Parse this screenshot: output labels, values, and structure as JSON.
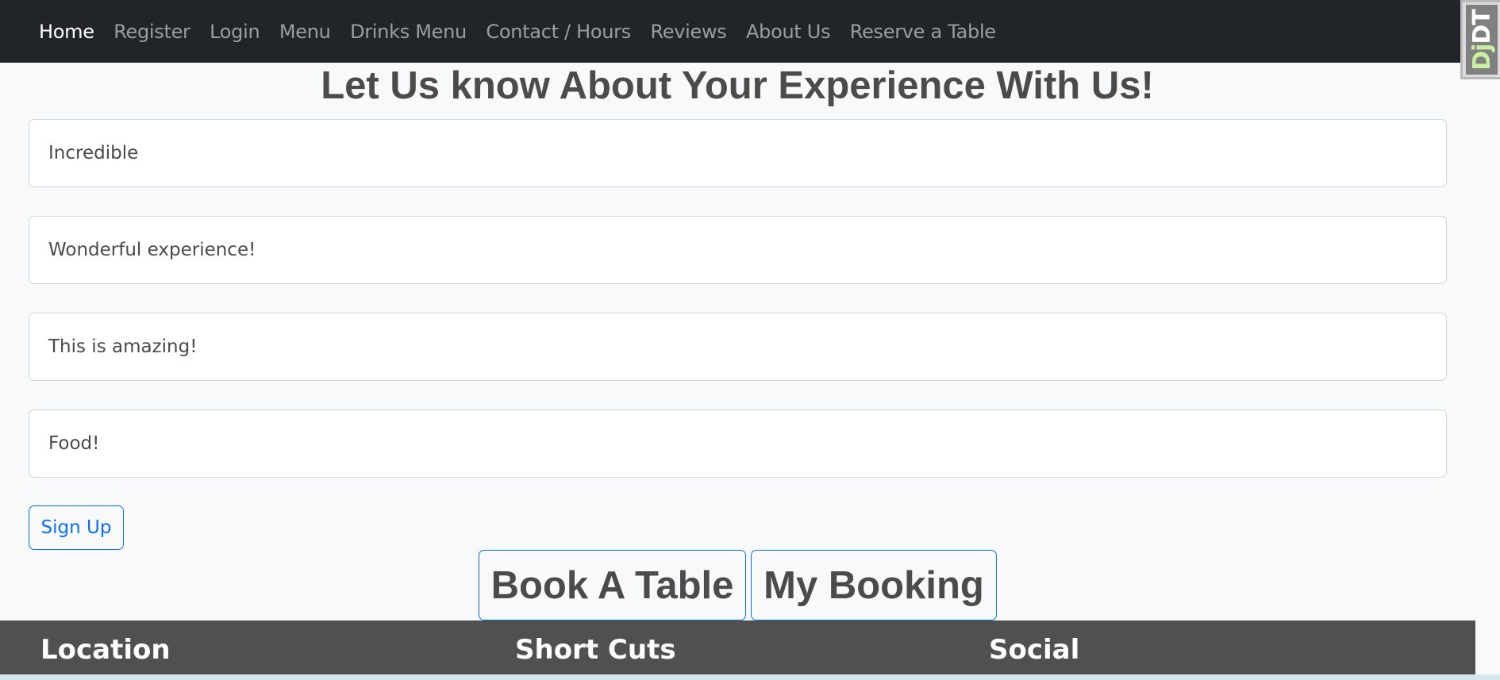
{
  "nav": {
    "items": [
      {
        "label": "Home",
        "active": true
      },
      {
        "label": "Register",
        "active": false
      },
      {
        "label": "Login",
        "active": false
      },
      {
        "label": "Menu",
        "active": false
      },
      {
        "label": "Drinks Menu",
        "active": false
      },
      {
        "label": "Contact / Hours",
        "active": false
      },
      {
        "label": "Reviews",
        "active": false
      },
      {
        "label": "About Us",
        "active": false
      },
      {
        "label": "Reserve a Table",
        "active": false
      }
    ]
  },
  "djdt": {
    "label_dj": "Dj",
    "label_dt": "DT"
  },
  "page": {
    "title": "Let Us know About Your Experience With Us!"
  },
  "reviews": [
    {
      "text": "Incredible"
    },
    {
      "text": "Wonderful experience!"
    },
    {
      "text": "This is amazing!"
    },
    {
      "text": "Food!"
    }
  ],
  "form": {
    "signup_label": "Sign Up"
  },
  "actions": {
    "book_label": "Book A Table",
    "booking_label": "My Booking"
  },
  "footer": {
    "location_heading": "Location",
    "shortcuts_heading": "Short Cuts",
    "social_heading": "Social"
  },
  "colors": {
    "navbar_bg": "#212529",
    "accent": "#0d6efd",
    "footer_bg": "#505050",
    "page_bg": "#f8f9fa"
  }
}
